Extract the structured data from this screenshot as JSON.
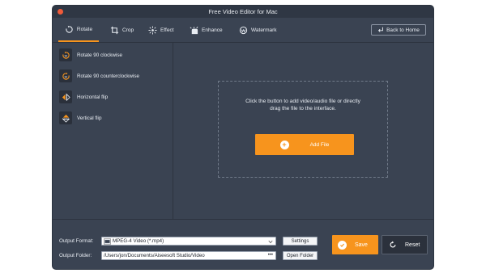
{
  "window": {
    "title": "Free Video Editor for Mac"
  },
  "toolbar": {
    "tabs": [
      {
        "label": "Rotate",
        "icon": "rotate-icon",
        "active": true
      },
      {
        "label": "Crop",
        "icon": "crop-icon"
      },
      {
        "label": "Effect",
        "icon": "effect-icon"
      },
      {
        "label": "Enhance",
        "icon": "enhance-icon"
      },
      {
        "label": "Watermark",
        "icon": "watermark-icon"
      }
    ],
    "back_label": "Back to Home"
  },
  "sidebar": {
    "items": [
      {
        "label": "Rotate 90 clockwise",
        "icon": "rotate-clockwise-icon"
      },
      {
        "label": "Rotate 90 counterclockwise",
        "icon": "rotate-counterclockwise-icon"
      },
      {
        "label": "Horizontal flip",
        "icon": "horizontal-flip-icon"
      },
      {
        "label": "Vertical flip",
        "icon": "vertical-flip-icon"
      }
    ]
  },
  "dropzone": {
    "line1": "Click the button to add video/audio file or directly",
    "line2": "drag the file to the interface.",
    "add_label": "Add File"
  },
  "output": {
    "format_label": "Output Format:",
    "format_value": "MPEG-4 Video (*.mp4)",
    "settings_label": "Settings",
    "folder_label": "Output Folder:",
    "folder_value": "/Users/jon/Documents/Aiseesoft Studio/Video",
    "folder_more": "•••",
    "open_folder_label": "Open Folder"
  },
  "actions": {
    "save_label": "Save",
    "reset_label": "Reset"
  },
  "colors": {
    "accent": "#f7941d",
    "background": "#3a4352",
    "titlebar": "#2f3744"
  }
}
